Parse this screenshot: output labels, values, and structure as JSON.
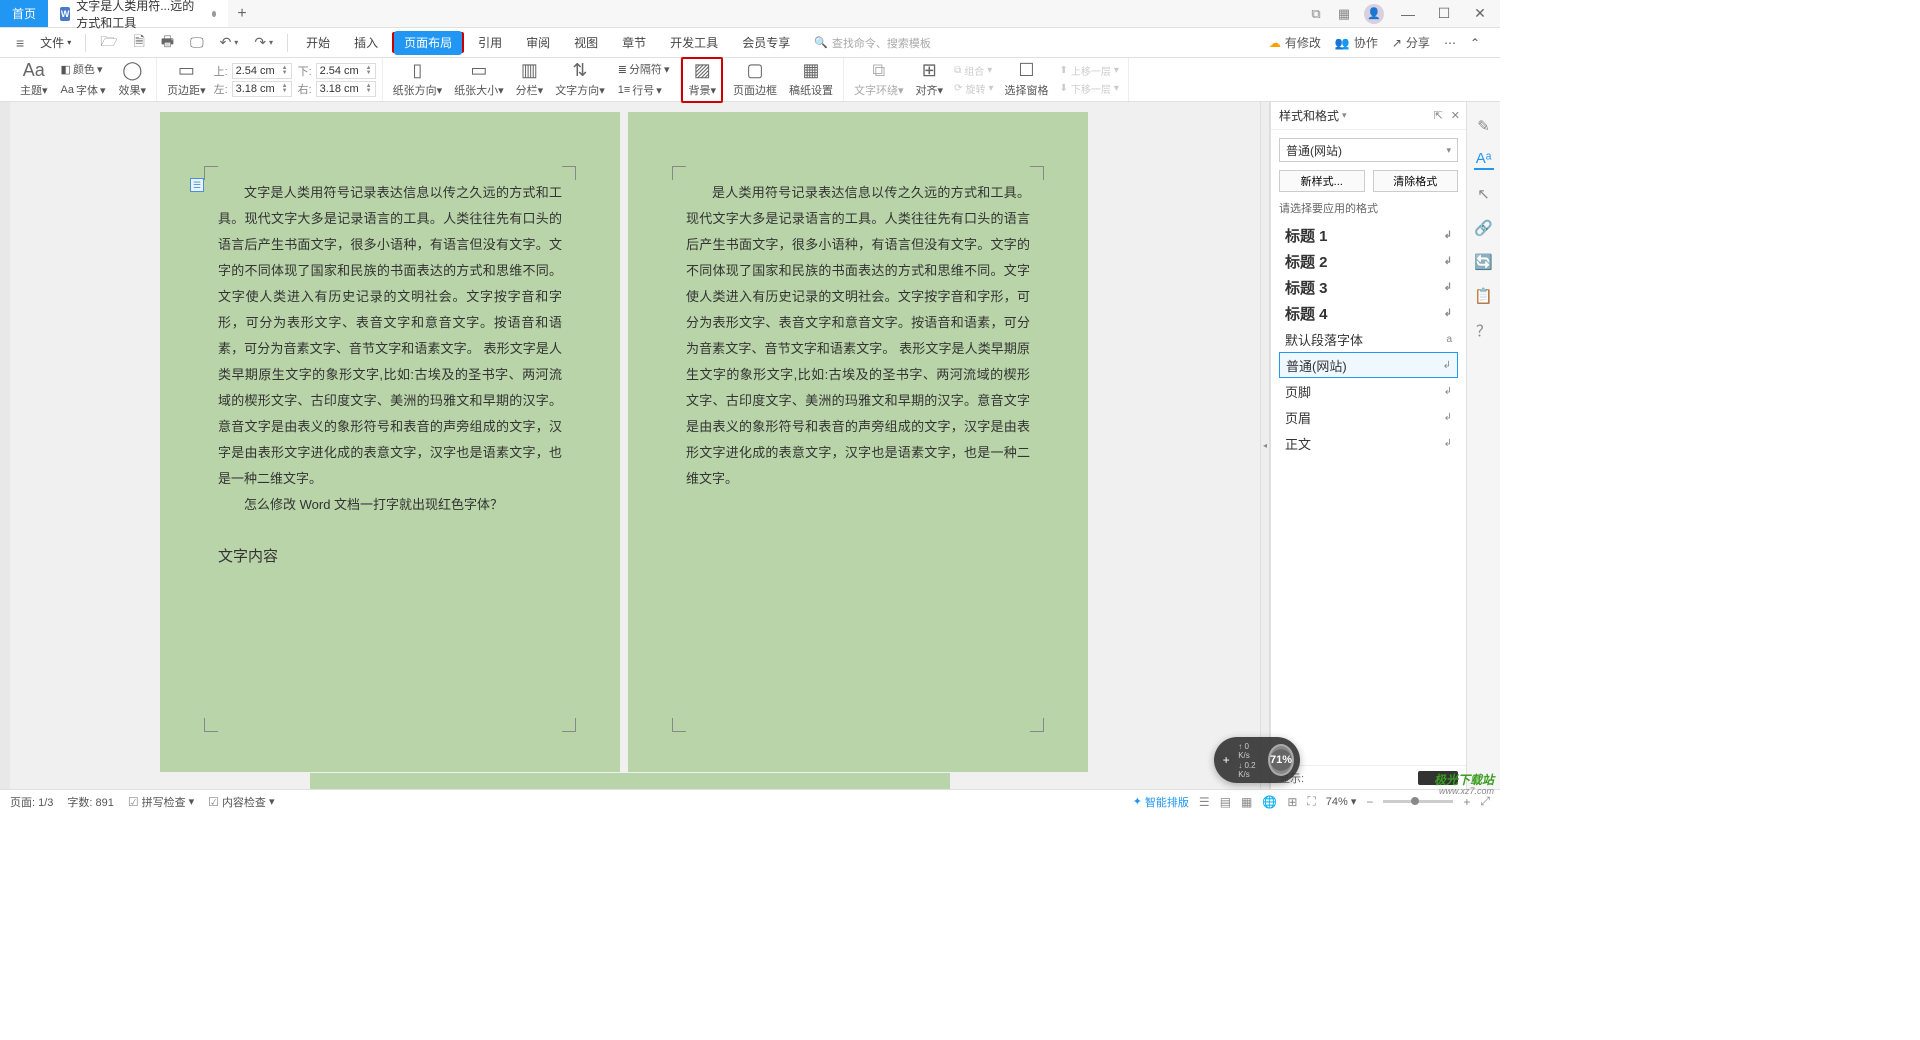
{
  "titlebar": {
    "home_tab": "首页",
    "doc_tab": "文字是人类用符...远的方式和工具",
    "doc_icon_letter": "W"
  },
  "menubar": {
    "file": "文件",
    "tabs": [
      "开始",
      "插入",
      "页面布局",
      "引用",
      "审阅",
      "视图",
      "章节",
      "开发工具",
      "会员专享"
    ],
    "active_tab_index": 2,
    "search_placeholder": "查找命令、搜索模板",
    "right": {
      "has_changes": "有修改",
      "collab": "协作",
      "share": "分享"
    }
  },
  "ribbon": {
    "theme": "主题",
    "font": "字体",
    "color": "颜色",
    "effect": "效果",
    "page_margin": "页边距",
    "margins": {
      "top_label": "上:",
      "top_val": "2.54 cm",
      "bottom_label": "下:",
      "bottom_val": "2.54 cm",
      "left_label": "左:",
      "left_val": "3.18 cm",
      "right_label": "右:",
      "right_val": "3.18 cm"
    },
    "orientation": "纸张方向",
    "paper_size": "纸张大小",
    "columns": "分栏",
    "text_direction": "文字方向",
    "line_number": "行号",
    "breaks": "分隔符",
    "background": "背景",
    "page_border": "页面边框",
    "manuscript": "稿纸设置",
    "text_wrap": "文字环绕",
    "align": "对齐",
    "rotate": "旋转",
    "group": "组合",
    "selection_pane": "选择窗格",
    "bring_forward": "上移一层",
    "send_backward": "下移一层"
  },
  "document": {
    "page1": {
      "tag": "☰",
      "para1": "文字是人类用符号记录表达信息以传之久远的方式和工具。现代文字大多是记录语言的工具。人类往往先有口头的语言后产生书面文字，很多小语种，有语言但没有文字。文字的不同体现了国家和民族的书面表达的方式和思维不同。文字使人类进入有历史记录的文明社会。文字按字音和字形，可分为表形文字、表音文字和意音文字。按语音和语素，可分为音素文字、音节文字和语素文字。 表形文字是人类早期原生文字的象形文字,比如:古埃及的圣书字、两河流域的楔形文字、古印度文字、美洲的玛雅文和早期的汉字。意音文字是由表义的象形符号和表音的声旁组成的文字，汉字是由表形文字进化成的表意文字，汉字也是语素文字，也是一种二维文字。",
      "para2": "怎么修改 Word 文档一打字就出现红色字体？",
      "heading": "文字内容"
    },
    "page2": {
      "para1": "是人类用符号记录表达信息以传之久远的方式和工具。现代文字大多是记录语言的工具。人类往往先有口头的语言后产生书面文字，很多小语种，有语言但没有文字。文字的不同体现了国家和民族的书面表达的方式和思维不同。文字使人类进入有历史记录的文明社会。文字按字音和字形，可分为表形文字、表音文字和意音文字。按语音和语素，可分为音素文字、音节文字和语素文字。 表形文字是人类早期原生文字的象形文字,比如:古埃及的圣书字、两河流域的楔形文字、古印度文字、美洲的玛雅文和早期的汉字。意音文字是由表义的象形符号和表音的声旁组成的文字，汉字是由表形文字进化成的表意文字，汉字也是语素文字，也是一种二维文字。"
    }
  },
  "styles_pane": {
    "title": "样式和格式",
    "current": "普通(网站)",
    "new_style": "新样式...",
    "clear_format": "清除格式",
    "prompt": "请选择要应用的格式",
    "items": [
      {
        "label": "标题 1",
        "mk": "↲",
        "h": true
      },
      {
        "label": "标题 2",
        "mk": "↲",
        "h": true
      },
      {
        "label": "标题 3",
        "mk": "↲",
        "h": true
      },
      {
        "label": "标题 4",
        "mk": "↲",
        "h": true
      },
      {
        "label": "默认段落字体",
        "mk": "a",
        "h": false
      },
      {
        "label": "普通(网站)",
        "mk": "↲",
        "h": false,
        "sel": true
      },
      {
        "label": "页脚",
        "mk": "↲",
        "h": false
      },
      {
        "label": "页眉",
        "mk": "↲",
        "h": false
      },
      {
        "label": "正文",
        "mk": "↲",
        "h": false
      }
    ],
    "footer_label": "显示:"
  },
  "statusbar": {
    "page": "页面: 1/3",
    "words": "字数: 891",
    "spell": "拼写检查",
    "content": "内容检查",
    "smart_layout": "智能排版",
    "zoom": "74%"
  },
  "float": {
    "up": "0 K/s",
    "down": "0.2 K/s",
    "pct": "71%"
  },
  "watermark": {
    "l1": "极光下载站",
    "l2": "www.xz7.com"
  }
}
